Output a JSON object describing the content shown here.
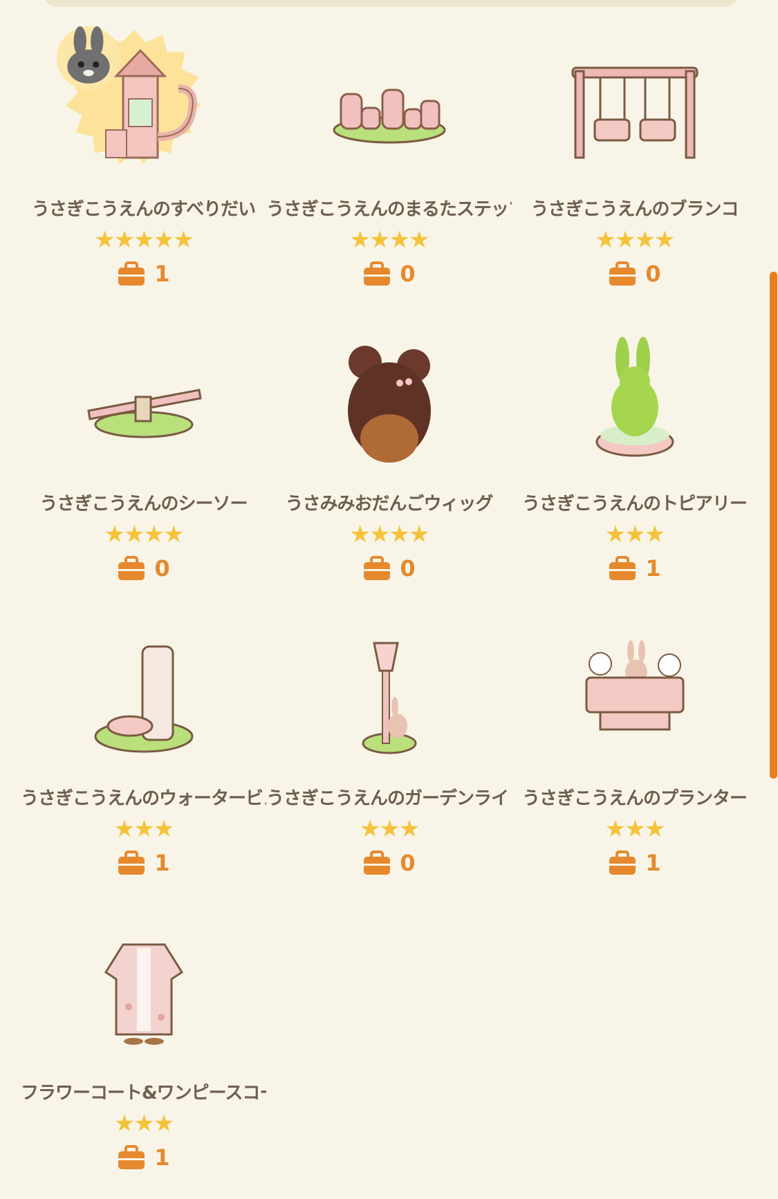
{
  "items": [
    {
      "name": "うさぎこうえんのすべりだい",
      "stars": "★★★★★",
      "count": "1",
      "icon": "slide-icon",
      "badge": "bunny-face-icon"
    },
    {
      "name": "うさぎこうえんのまるたステップ",
      "stars": "★★★★",
      "count": "0",
      "icon": "log-steps-icon"
    },
    {
      "name": "うさぎこうえんのブランコ",
      "stars": "★★★★",
      "count": "0",
      "icon": "swing-icon"
    },
    {
      "name": "うさぎこうえんのシーソー",
      "stars": "★★★★",
      "count": "0",
      "icon": "seesaw-icon"
    },
    {
      "name": "うさみみおだんごウィッグ",
      "stars": "★★★★",
      "count": "0",
      "icon": "bun-wig-icon"
    },
    {
      "name": "うさぎこうえんのトピアリー",
      "stars": "★★★",
      "count": "1",
      "icon": "rabbit-topiary-icon"
    },
    {
      "name": "うさぎこうえんのウォータービュー",
      "stars": "★★★",
      "count": "1",
      "icon": "water-fountain-icon"
    },
    {
      "name": "うさぎこうえんのガーデンライト",
      "stars": "★★★",
      "count": "0",
      "icon": "garden-light-icon"
    },
    {
      "name": "うさぎこうえんのプランター",
      "stars": "★★★",
      "count": "1",
      "icon": "planter-icon"
    },
    {
      "name": "フラワーコート&ワンピースコーデ",
      "stars": "★★★",
      "count": "1",
      "icon": "flower-coat-icon"
    }
  ],
  "colors": {
    "background": "#f8f5e8",
    "star": "#f5c33b",
    "bag": "#e6892e",
    "text": "#6e5d4d",
    "scrollbar": "#e67e22"
  }
}
